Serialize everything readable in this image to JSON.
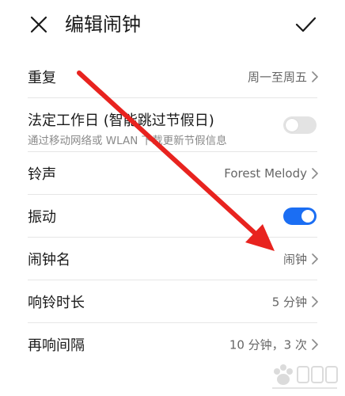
{
  "header": {
    "title": "编辑闹钟",
    "close_icon": "close-icon",
    "confirm_icon": "check-icon"
  },
  "settings": [
    {
      "key": "repeat",
      "label": "重复",
      "value": "周一至周五"
    },
    {
      "key": "legal_workday",
      "label": "法定工作日 (智能跳过节假日)",
      "sublabel": "通过移动网络或 WLAN 下载更新节假信息",
      "toggle": false
    },
    {
      "key": "ringtone",
      "label": "铃声",
      "value": "Forest Melody"
    },
    {
      "key": "vibrate",
      "label": "振动",
      "toggle": true
    },
    {
      "key": "alarm_name",
      "label": "闹钟名",
      "value": "闹钟"
    },
    {
      "key": "ring_duration",
      "label": "响铃时长",
      "value": "5 分钟"
    },
    {
      "key": "snooze_interval",
      "label": "再响间隔",
      "value": "10 分钟，3 次"
    }
  ],
  "colors": {
    "toggle_on": "#1b6ef3",
    "toggle_off": "#e3e3e3",
    "annotation_arrow": "#e8231f"
  }
}
